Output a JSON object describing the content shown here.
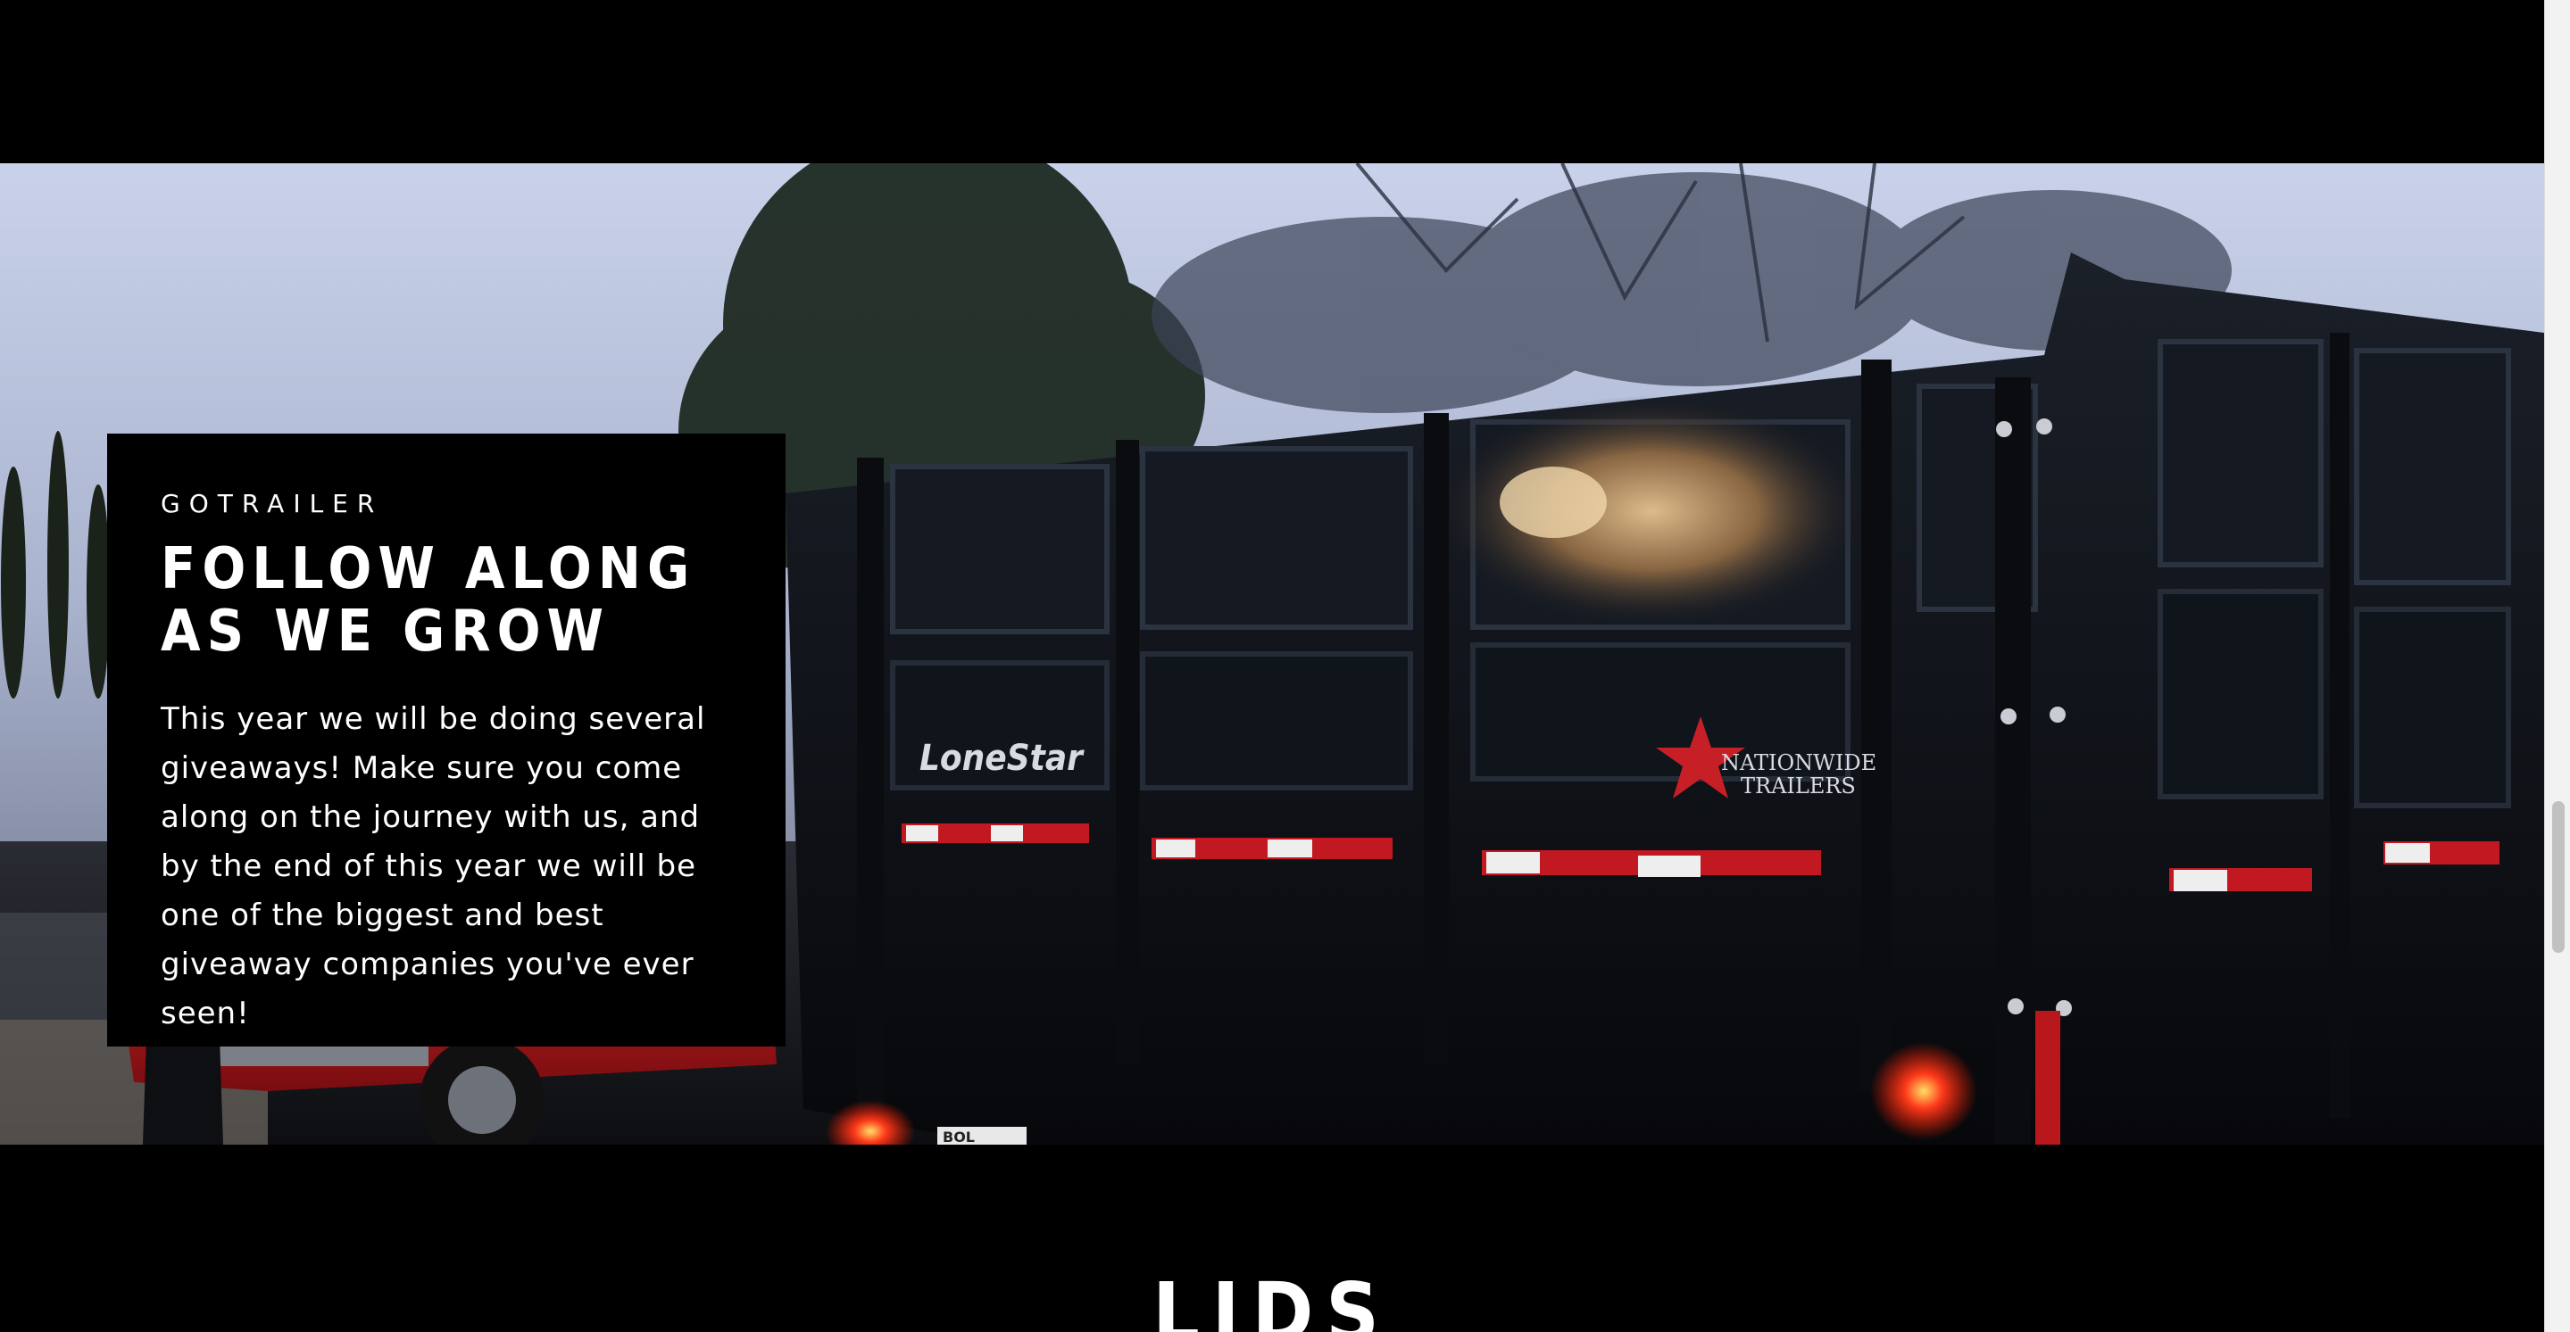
{
  "feature": {
    "eyebrow": "GOTRAILER",
    "title": "FOLLOW ALONG AS WE GROW",
    "body": "This year we will be doing several giveaways! Make sure you come along on the journey with us, and by the end of this year we will be one of the biggest and best giveaway companies you've ever seen!"
  },
  "photo": {
    "brand_left": "LoneStar",
    "brand_right_line1": "NATIONWIDE",
    "brand_right_line2": "TRAILERS",
    "plate_text": "BOL"
  },
  "next_section": {
    "title": "LIDS"
  },
  "colors": {
    "background": "#000000",
    "text": "#ffffff",
    "truck": "#c0141a",
    "trailer": "#10131a"
  }
}
